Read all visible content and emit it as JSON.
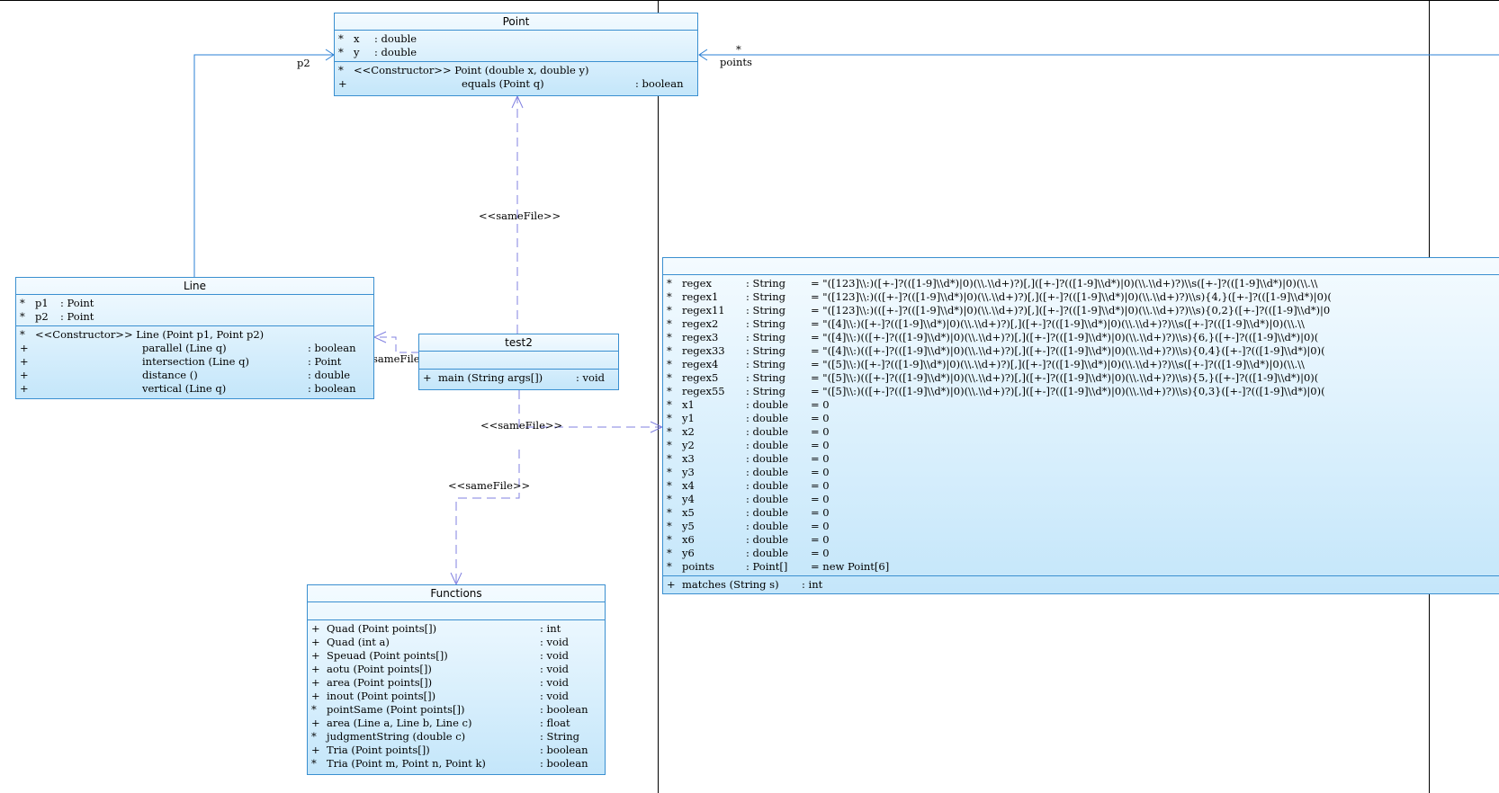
{
  "classes": {
    "point": {
      "name": "Point",
      "attributes": [
        {
          "vis": "*",
          "name": "x",
          "type": ": double"
        },
        {
          "vis": "*",
          "name": "y",
          "type": ": double"
        }
      ],
      "operations": [
        {
          "vis": "*",
          "sig": "<<Constructor>> Point (double x, double y)",
          "ret": ""
        },
        {
          "vis": "+",
          "sig": "equals (Point q)",
          "ret": ": boolean"
        }
      ]
    },
    "line": {
      "name": "Line",
      "attributes": [
        {
          "vis": "*",
          "name": "p1",
          "type": ": Point"
        },
        {
          "vis": "*",
          "name": "p2",
          "type": ": Point"
        }
      ],
      "operations": [
        {
          "vis": "*",
          "sig": "<<Constructor>> Line (Point p1, Point p2)",
          "ret": ""
        },
        {
          "vis": "+",
          "sig": "parallel (Line q)",
          "ret": ": boolean"
        },
        {
          "vis": "+",
          "sig": "intersection (Line q)",
          "ret": ": Point"
        },
        {
          "vis": "+",
          "sig": "distance ()",
          "ret": ": double"
        },
        {
          "vis": "+",
          "sig": "vertical (Line q)",
          "ret": ": boolean"
        }
      ]
    },
    "test2": {
      "name": "test2",
      "operations": [
        {
          "vis": "+",
          "sig": "main (String args[])",
          "ret": ": void"
        }
      ]
    },
    "functions": {
      "name": "Functions",
      "operations": [
        {
          "vis": "+",
          "sig": "Quad (Point points[])",
          "ret": ": int"
        },
        {
          "vis": "+",
          "sig": "Quad (int a)",
          "ret": ": void"
        },
        {
          "vis": "+",
          "sig": "Speuad (Point points[])",
          "ret": ": void"
        },
        {
          "vis": "+",
          "sig": "aotu (Point points[])",
          "ret": ": void"
        },
        {
          "vis": "+",
          "sig": "area (Point points[])",
          "ret": ": void"
        },
        {
          "vis": "+",
          "sig": "inout (Point points[])",
          "ret": ": void"
        },
        {
          "vis": "*",
          "sig": "pointSame (Point points[])",
          "ret": ": boolean"
        },
        {
          "vis": "+",
          "sig": "area (Line a, Line b, Line c)",
          "ret": ": float"
        },
        {
          "vis": "*",
          "sig": "judgmentString (double c)",
          "ret": ": String"
        },
        {
          "vis": "+",
          "sig": "Tria (Point points[])",
          "ret": ": boolean"
        },
        {
          "vis": "*",
          "sig": "Tria (Point m, Point n, Point k)",
          "ret": ": boolean"
        }
      ]
    },
    "main": {
      "name": "",
      "attributes": [
        {
          "vis": "*",
          "name": "regex",
          "type": ": String",
          "val": "= \"([123]\\\\:)([+-]?(([1-9]\\\\d*)|0)(\\\\.\\\\d+)?)[,]([+-]?(([1-9]\\\\d*)|0)(\\\\.\\\\d+)?)\\\\s([+-]?(([1-9]\\\\d*)|0)(\\\\.\\\\"
        },
        {
          "vis": "*",
          "name": "regex1",
          "type": ": String",
          "val": "= \"([123]\\\\:)(([+-]?(([1-9]\\\\d*)|0)(\\\\.\\\\d+)?)[,]([+-]?(([1-9]\\\\d*)|0)(\\\\.\\\\d+)?)\\\\s){4,}([+-]?(([1-9]\\\\d*)|0)("
        },
        {
          "vis": "*",
          "name": "regex11",
          "type": ": String",
          "val": "= \"([123]\\\\:)(([+-]?(([1-9]\\\\d*)|0)(\\\\.\\\\d+)?)[,]([+-]?(([1-9]\\\\d*)|0)(\\\\.\\\\d+)?)\\\\s){0,2}([+-]?(([1-9]\\\\d*)|0"
        },
        {
          "vis": "*",
          "name": "regex2",
          "type": ": String",
          "val": "= \"([4]\\\\:)([+-]?(([1-9]\\\\d*)|0)(\\\\.\\\\d+)?)[,]([+-]?(([1-9]\\\\d*)|0)(\\\\.\\\\d+)?)\\\\s([+-]?(([1-9]\\\\d*)|0)(\\\\.\\\\"
        },
        {
          "vis": "*",
          "name": "regex3",
          "type": ": String",
          "val": "= \"([4]\\\\:)(([+-]?(([1-9]\\\\d*)|0)(\\\\.\\\\d+)?)[,]([+-]?(([1-9]\\\\d*)|0)(\\\\.\\\\d+)?)\\\\s){6,}([+-]?(([1-9]\\\\d*)|0)("
        },
        {
          "vis": "*",
          "name": "regex33",
          "type": ": String",
          "val": "= \"([4]\\\\:)(([+-]?(([1-9]\\\\d*)|0)(\\\\.\\\\d+)?)[,]([+-]?(([1-9]\\\\d*)|0)(\\\\.\\\\d+)?)\\\\s){0,4}([+-]?(([1-9]\\\\d*)|0)("
        },
        {
          "vis": "*",
          "name": "regex4",
          "type": ": String",
          "val": "= \"([5]\\\\:)([+-]?(([1-9]\\\\d*)|0)(\\\\.\\\\d+)?)[,]([+-]?(([1-9]\\\\d*)|0)(\\\\.\\\\d+)?)\\\\s([+-]?(([1-9]\\\\d*)|0)(\\\\.\\\\"
        },
        {
          "vis": "*",
          "name": "regex5",
          "type": ": String",
          "val": "= \"([5]\\\\:)(([+-]?(([1-9]\\\\d*)|0)(\\\\.\\\\d+)?)[,]([+-]?(([1-9]\\\\d*)|0)(\\\\.\\\\d+)?)\\\\s){5,}([+-]?(([1-9]\\\\d*)|0)("
        },
        {
          "vis": "*",
          "name": "regex55",
          "type": ": String",
          "val": "= \"([5]\\\\:)(([+-]?(([1-9]\\\\d*)|0)(\\\\.\\\\d+)?)[,]([+-]?(([1-9]\\\\d*)|0)(\\\\.\\\\d+)?)\\\\s){0,3}([+-]?(([1-9]\\\\d*)|0)("
        },
        {
          "vis": "*",
          "name": "x1",
          "type": ": double",
          "val": "= 0"
        },
        {
          "vis": "*",
          "name": "y1",
          "type": ": double",
          "val": "= 0"
        },
        {
          "vis": "*",
          "name": "x2",
          "type": ": double",
          "val": "= 0"
        },
        {
          "vis": "*",
          "name": "y2",
          "type": ": double",
          "val": "= 0"
        },
        {
          "vis": "*",
          "name": "x3",
          "type": ": double",
          "val": "= 0"
        },
        {
          "vis": "*",
          "name": "y3",
          "type": ": double",
          "val": "= 0"
        },
        {
          "vis": "*",
          "name": "x4",
          "type": ": double",
          "val": "= 0"
        },
        {
          "vis": "*",
          "name": "y4",
          "type": ": double",
          "val": "= 0"
        },
        {
          "vis": "*",
          "name": "x5",
          "type": ": double",
          "val": "= 0"
        },
        {
          "vis": "*",
          "name": "y5",
          "type": ": double",
          "val": "= 0"
        },
        {
          "vis": "*",
          "name": "x6",
          "type": ": double",
          "val": "= 0"
        },
        {
          "vis": "*",
          "name": "y6",
          "type": ": double",
          "val": "= 0"
        },
        {
          "vis": "*",
          "name": "points",
          "type": ": Point[]",
          "val": "= new Point[6]"
        }
      ],
      "operations": [
        {
          "vis": "+",
          "sig": "matches (String s)",
          "ret": ": int"
        }
      ]
    }
  },
  "labels": {
    "p2": "p2",
    "multiplicity": "*",
    "points": "points",
    "samefile_1": "<<sameFile>>",
    "samefile_2": "sameFile",
    "samefile_3": "<<sameFile>>",
    "samefile_4": "<<sameFile>>"
  },
  "colors": {
    "association_line": "#2a7fd4",
    "dependency_line": "#8080e0",
    "class_border": "#3a8fd0",
    "frame_line": "#000000"
  }
}
